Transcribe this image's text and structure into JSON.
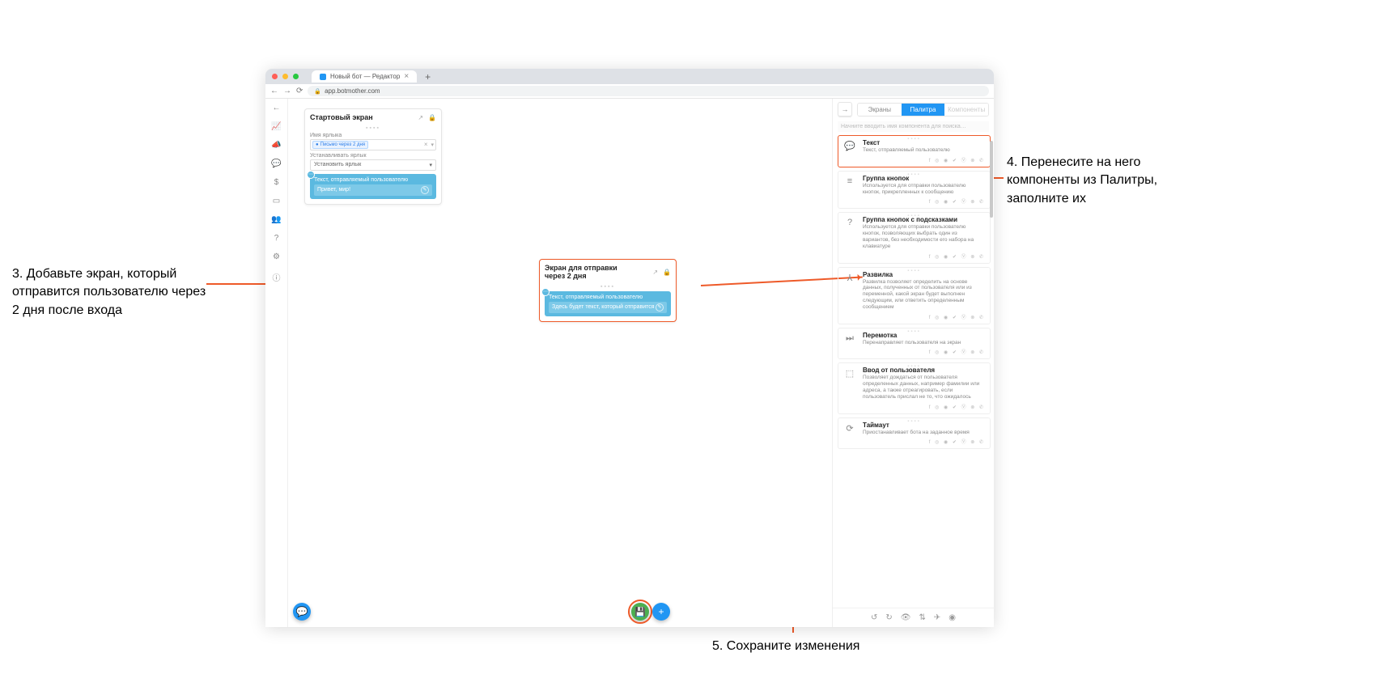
{
  "annotations": {
    "left": "3. Добавьте экран, который отправится пользователю через 2 дня после входа",
    "right": "4. Перенесите на него компоненты из Палитры, заполните их",
    "bottom": "5. Сохраните изменения"
  },
  "browser": {
    "tab_title": "Новый бот — Редактор",
    "url": "app.botmother.com"
  },
  "canvas": {
    "screen1": {
      "title": "Стартовый экран",
      "label_name_field": "Имя ярлыка",
      "tag_value": "Письмо через 2 дня",
      "set_label_field": "Устанавливать ярлык",
      "set_label_placeholder": "Установить ярлык",
      "component_title": "Текст, отправляемый пользователю",
      "component_text": "Привет, мир!"
    },
    "screen2": {
      "title": "Экран для отправки через 2 дня",
      "component_title": "Текст, отправляемый пользователю",
      "component_text": "Здесь будет текст, который отправится"
    }
  },
  "right_panel": {
    "tabs": {
      "screens": "Экраны",
      "palette": "Палитра",
      "components": "Компоненты"
    },
    "search_placeholder": "Начните вводить имя компонента для поиска…",
    "platforms_str": "f ◎ ◉ ✔ Ⓥ ⊗ ✆",
    "items": [
      {
        "icon": "💬",
        "title": "Текст",
        "desc": "Текст, отправляемый пользователю"
      },
      {
        "icon": "≡",
        "title": "Группа кнопок",
        "desc": "Используется для отправки пользователю кнопок, прикрепленных к сообщению"
      },
      {
        "icon": "?",
        "title": "Группа кнопок с подсказками",
        "desc": "Используется для отправки пользователю кнопок, позволяющих выбрать один из вариантов, без необходимости его набора на клавиатуре"
      },
      {
        "icon": "⅄",
        "title": "Развилка",
        "desc": "Развилка позволяет определить на основе данных, полученных от пользователя или из переменной, какой экран будет выполнен следующим, или ответить определенным сообщением"
      },
      {
        "icon": "⏭",
        "title": "Перемотка",
        "desc": "Перенаправляет пользователя на экран"
      },
      {
        "icon": "⬚",
        "title": "Ввод от пользователя",
        "desc": "Позволяет дождаться от пользователя определенных данных, например фамилии или адреса, а также отреагировать, если пользователь прислал не то, что ожидалось"
      },
      {
        "icon": "⟳",
        "title": "Таймаут",
        "desc": "Приостанавливает бота на заданное время"
      }
    ]
  }
}
